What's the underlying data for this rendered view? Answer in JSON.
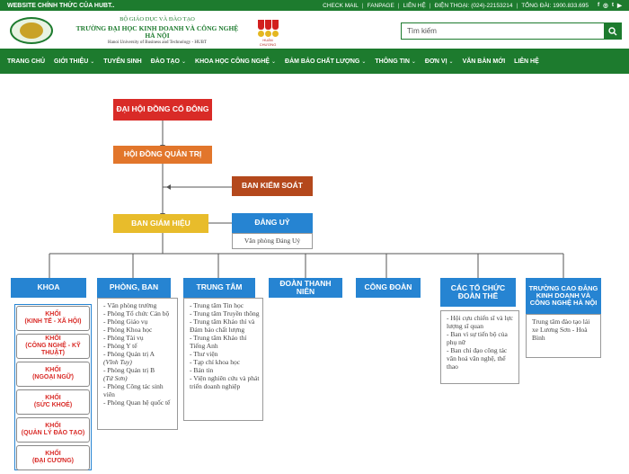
{
  "topbar": {
    "left": "WEBSITE CHÍNH THỨC CỦA HUBT..",
    "links": [
      "CHECK MAIL",
      "FANPAGE",
      "LIÊN HỆ",
      "ĐIỆN THOẠI: (024)-22153214",
      "TỔNG ĐÀI: 1900.833.695"
    ],
    "social": [
      "f",
      "◎",
      "t",
      "▶"
    ]
  },
  "header": {
    "line1": "BỘ GIÁO DỤC VÀ ĐÀO TẠO",
    "line2": "TRƯỜNG ĐẠI HỌC KINH DOANH VÀ CÔNG NGHỆ HÀ NỘI",
    "line3": "Hanoi University of Business and Technology - HUBT",
    "medal_caption": "HUÂN CHƯƠNG",
    "search_placeholder": "Tìm kiếm"
  },
  "nav": [
    {
      "label": "TRANG CHỦ",
      "chev": false
    },
    {
      "label": "GIỚI THIỆU",
      "chev": true
    },
    {
      "label": "TUYỂN SINH",
      "chev": false
    },
    {
      "label": "ĐÀO TẠO",
      "chev": true
    },
    {
      "label": "KHOA HỌC CÔNG NGHỆ",
      "chev": true
    },
    {
      "label": "ĐẢM BẢO CHẤT LƯỢNG",
      "chev": true
    },
    {
      "label": "THÔNG TIN",
      "chev": true
    },
    {
      "label": "ĐƠN VỊ",
      "chev": true
    },
    {
      "label": "VĂN BẢN MỚI",
      "chev": false
    },
    {
      "label": "LIÊN HỆ",
      "chev": false
    }
  ],
  "org": {
    "dai_hoi": "ĐẠI HỘI ĐỒNG CỔ ĐÔNG",
    "hoi_dong": "HỘI ĐỒNG QUẢN TRỊ",
    "ban_kiem_soat": "BAN KIỂM SOÁT",
    "ban_giam_hieu": "BAN GIÁM HIỆU",
    "dang_uy": "ĐẢNG UỶ",
    "van_phong_dang_uy": "Văn phòng Đảng Uỷ",
    "khoa": "KHOA",
    "phong_ban": "PHÒNG, BAN",
    "trung_tam": "TRUNG TÂM",
    "doan_thanh_nien": "ĐOÀN THANH NIÊN",
    "cong_doan": "CÔNG ĐOÀN",
    "cac_to_chuc": "CÁC TỔ CHỨC ĐOÀN THỂ",
    "truong_cao_dang": "TRƯỜNG CAO ĐẲNG KINH DOANH VÀ CÔNG NGHỆ HÀ NỘI",
    "khoi": [
      {
        "title": "KHỐI",
        "sub": "(KINH TẾ - XÃ HỘI)"
      },
      {
        "title": "KHỐI",
        "sub": "(CÔNG NGHỆ - KỸ THUẬT)"
      },
      {
        "title": "KHỐI",
        "sub": "(NGOẠI NGỮ)"
      },
      {
        "title": "KHỐI",
        "sub": "(SỨC KHOẺ)"
      },
      {
        "title": "KHỐI",
        "sub": "(QUẢN LÝ ĐÀO TẠO)"
      },
      {
        "title": "KHỐI",
        "sub": "(ĐẠI CƯƠNG)"
      }
    ],
    "phong_ban_items": [
      "- Văn phòng trường",
      "- Phòng Tổ chức Cán bộ",
      "- Phòng Giáo vụ",
      "- Phòng Khoa học",
      "- Phòng Tài vụ",
      "- Phòng Y tế",
      "- Phòng Quản trị A",
      "(Vĩnh Tuy)",
      "- Phòng Quản trị B",
      "(Tứ Sơn)",
      "- Phòng Công tác sinh viên",
      "- Phòng Quan hệ quốc tế"
    ],
    "trung_tam_items": [
      "- Trung tâm Tin học",
      "- Trung tâm Truyền thông",
      "- Trung tâm Khảo thí và Đảm bảo chất lượng",
      "- Trung tâm Khảo thí Tiếng Anh",
      "- Thư viện",
      "- Tạp chí khoa học",
      "- Bản tin",
      "- Viện nghiên cứu và phát triển doanh nghiệp"
    ],
    "to_chuc_items": [
      "- Hội cựu chiến sĩ và lực lượng sĩ quan",
      "- Ban vì sự tiến bộ của phụ nữ",
      "- Ban chỉ đạo công tác văn hoá văn nghệ, thể thao"
    ],
    "truong_cd_text": "Trung tâm đào tạo lái xe Lương Sơn - Hoà Bình"
  },
  "colors": {
    "brand_green": "#1d7b2e",
    "red": "#d92b27",
    "orange": "#e2762b",
    "brown": "#b4481c",
    "gold": "#e8bc2b",
    "blue": "#2684d2"
  }
}
